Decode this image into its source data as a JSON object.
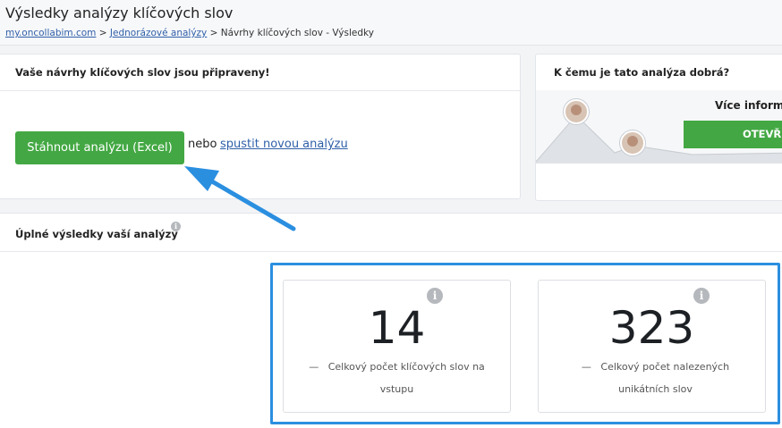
{
  "page": {
    "title": "Výsledky analýzy klíčových slov",
    "breadcrumb": {
      "home": "my.oncollabim.com",
      "sep1": " > ",
      "parent": "Jednorázové analýzy",
      "sep2": " > ",
      "current": "Návrhy klíčových slov - Výsledky"
    }
  },
  "ready_card": {
    "title": "Vaše návrhy klíčových slov jsou připraveny!",
    "download_label": "Stáhnout analýzu (Excel)",
    "or_text": "nebo",
    "new_analysis_label": "spustit novou analýzu"
  },
  "help_card": {
    "title": "K čemu je tato analýza dobrá?",
    "more_info": "Více informa",
    "open_label": "OTEVŘ"
  },
  "results": {
    "title": "Úplné výsledky vaší analýzy",
    "stats": [
      {
        "value": "14",
        "dash": "—",
        "label": "Celkový počet klíčových slov na vstupu"
      },
      {
        "value": "323",
        "dash": "—",
        "label": "Celkový počet nalezených unikátních slov"
      }
    ]
  },
  "colors": {
    "accent_green": "#43a843",
    "highlight_blue": "#2b8fe0",
    "link_blue": "#2f5fa8"
  },
  "icons": {
    "info": "info-icon",
    "arrow": "pointer-arrow"
  }
}
